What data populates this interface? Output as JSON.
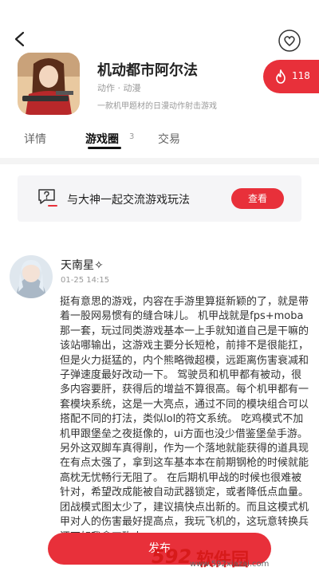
{
  "game": {
    "title": "机动都市阿尔法",
    "tags": "动作 · 动漫",
    "description": "一款机甲题材的日漫动作射击游戏",
    "hot_count": "118"
  },
  "tabs": [
    {
      "label": "详情"
    },
    {
      "label": "游戏圈",
      "count": "3"
    },
    {
      "label": "交易"
    }
  ],
  "banner": {
    "text": "与大神一起交流游戏玩法",
    "button": "查看"
  },
  "post": {
    "username": "天南星✧",
    "time": "01-25 14:15",
    "content": "挺有意思的游戏，内容在手游里算挺新颖的了，就是带着一股网易惯有的缝合味儿。 机甲战就是fps+moba那一套，玩过同类游戏基本一上手就知道自己是干嘛的该站哪输出，这游戏主要分长短枪，前排不是很能扛，但是火力挺猛的，内个熊略微超模，远距离伤害衰减和子弹速度最好改动一下。 驾驶员和机甲都有被动，很多内容要肝，获得后的增益不算很高。每个机甲都有一套模块系统，这是一大亮点，通过不同的模块组合可以搭配不同的打法，类似lol的符文系统。 吃鸡模式不加机甲跟堡垒之夜挺像的，ui方面也没少借鉴堡垒手游。另外这双脚车真得削，作为一个落地就能获得的道具现在有点太强了，拿到这车基本本在前期钢枪的时候就能高枕无忧畅行无阻了。 在后期机甲战的时候也很难被针对，希望改成能被自动武器锁定，或者降低点血量。 团战模式图太少了，建议搞快点出新的。而且这模式机甲对人的伤害最好提高点，我玩飞机的，这玩意转换兵还不如我拿刀砍人"
  },
  "publish_button": "发布",
  "watermark": {
    "brand": "592",
    "name": "软件园",
    "url": "www.592xiazai.com"
  }
}
